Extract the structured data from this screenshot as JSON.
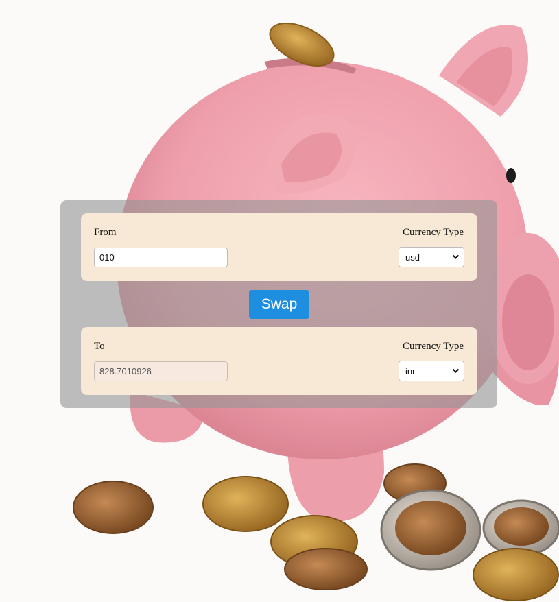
{
  "background": {
    "image": "piggy-bank-with-coins"
  },
  "from_box": {
    "label": "From",
    "amount_value": "010",
    "currency_label": "Currency Type",
    "currency_selected": "usd"
  },
  "swap_label": "Swap",
  "to_box": {
    "label": "To",
    "amount_value": "828.7010926",
    "currency_label": "Currency Type",
    "currency_selected": "inr"
  },
  "colors": {
    "swap_button": "#1e8fe0",
    "box_background": "#f8e8d6",
    "panel_overlay": "#969696"
  }
}
